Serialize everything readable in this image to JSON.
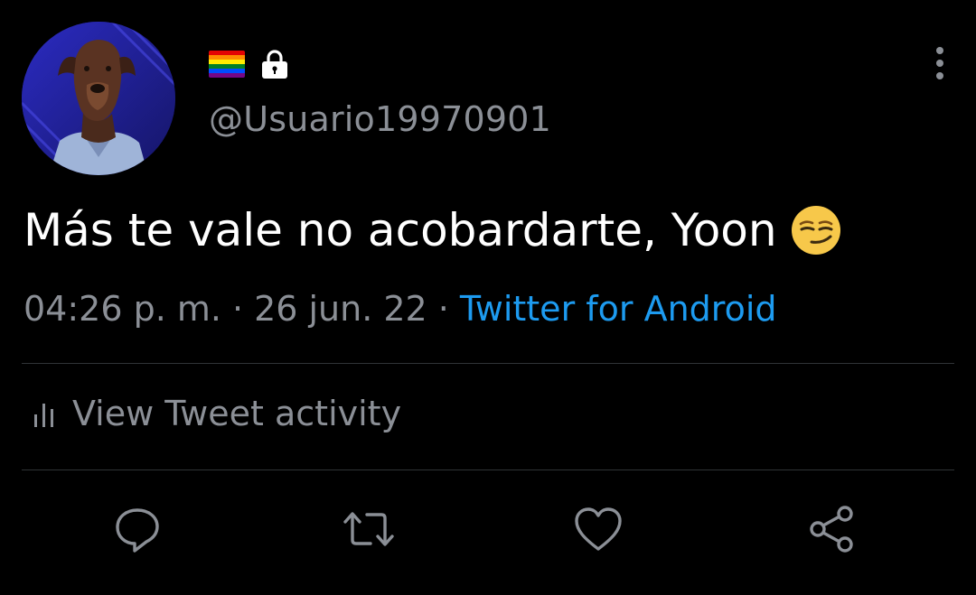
{
  "header": {
    "flag_icon": "rainbow-flag-icon",
    "flag_colors": [
      "#e40303",
      "#ff8c00",
      "#ffed00",
      "#008026",
      "#004dff",
      "#750787"
    ],
    "lock_icon": "lock-icon",
    "handle": "@Usuario19970901",
    "more_icon": "more-vertical-icon"
  },
  "tweet": {
    "text": "Más te vale no acobardarte, Yoon",
    "emoji_icon": "smirking-face-emoji"
  },
  "meta": {
    "time": "04:26 p. m.",
    "separator": "·",
    "date": "26 jun. 22",
    "source": "Twitter for Android"
  },
  "activity": {
    "icon": "bar-chart-icon",
    "label": "View Tweet activity"
  },
  "actions": [
    {
      "name": "reply",
      "icon": "reply-icon"
    },
    {
      "name": "retweet",
      "icon": "retweet-icon"
    },
    {
      "name": "like",
      "icon": "heart-icon"
    },
    {
      "name": "share",
      "icon": "share-icon"
    }
  ],
  "colors": {
    "background": "#000000",
    "text": "#ffffff",
    "muted": "#8b8f96",
    "accent": "#1d9bf0",
    "divider": "#2f3336"
  }
}
